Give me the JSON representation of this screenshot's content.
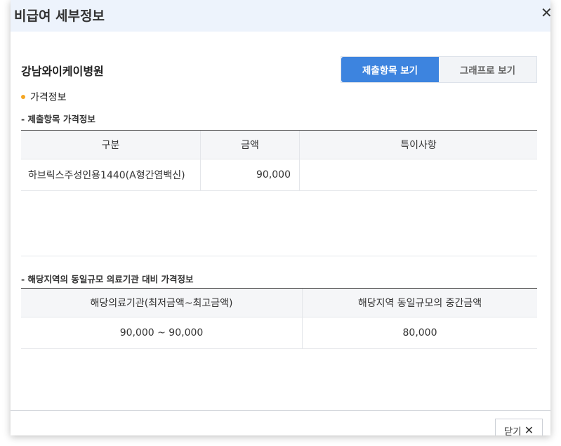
{
  "modal": {
    "title": "비급여 세부정보",
    "close_icon": "✕"
  },
  "hospital": {
    "name": "강남와이케이병원"
  },
  "view_toggle": {
    "items_label": "제출항목 보기",
    "graph_label": "그래프로 보기"
  },
  "section": {
    "title": "가격정보"
  },
  "submitted_prices": {
    "title": "- 제출항목 가격정보",
    "headers": [
      "구분",
      "금액",
      "특이사항"
    ],
    "rows": [
      [
        "하브릭스주성인용1440(A형간염백신)",
        "90,000",
        ""
      ]
    ]
  },
  "regional_prices": {
    "title": "- 해당지역의 동일규모 의료기관 대비 가격정보",
    "headers": [
      "해당의료기관(최저금액~최고금액)",
      "해당지역 동일규모의 중간금액"
    ],
    "rows": [
      [
        "90,000 ~ 90,000",
        "80,000"
      ]
    ]
  },
  "footer": {
    "close_label": "닫기",
    "close_icon": "✕"
  },
  "colors": {
    "accent": "#3d84df",
    "header_bg": "#edf3fc",
    "bullet": "#f5a623"
  }
}
